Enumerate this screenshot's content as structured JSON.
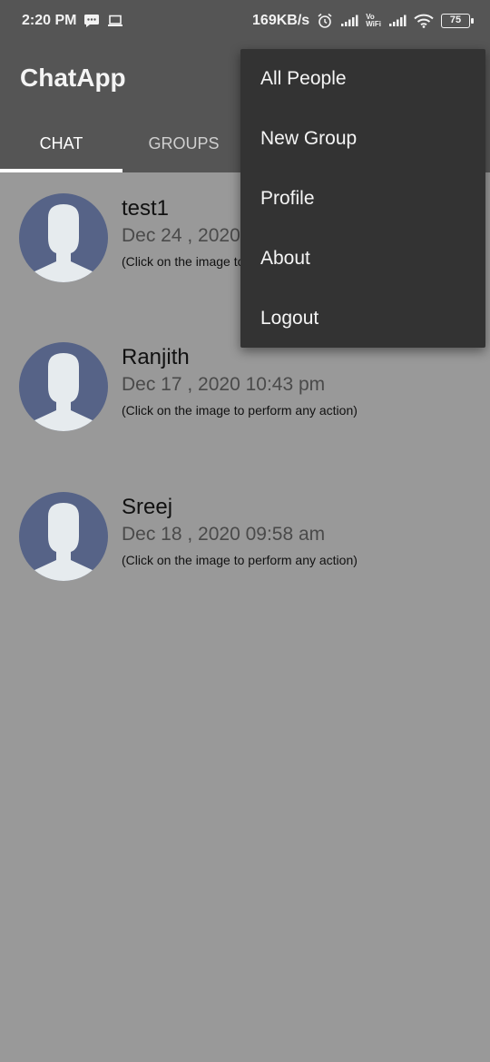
{
  "status_bar": {
    "time": "2:20 PM",
    "network_speed": "169KB/s",
    "vowifi_top": "Vo",
    "vowifi_bottom": "WiFi",
    "battery": "75",
    "icons": [
      "message-icon",
      "laptop-icon",
      "alarm-icon",
      "signal-icon",
      "signal-icon",
      "wifi-icon",
      "battery-icon"
    ]
  },
  "app_bar": {
    "title": "ChatApp"
  },
  "tabs": [
    {
      "label": "CHAT",
      "active": true
    },
    {
      "label": "GROUPS",
      "active": false
    }
  ],
  "chats": [
    {
      "name": "test1",
      "date": "Dec 24 , 2020",
      "hint": "(Click on the image to"
    },
    {
      "name": "Ranjith",
      "date": "Dec 17 , 2020 10:43 pm",
      "hint": "(Click on the image to perform any action)"
    },
    {
      "name": "Sreej",
      "date": "Dec 18 , 2020 09:58 am",
      "hint": "(Click on the image to perform any action)"
    }
  ],
  "menu": {
    "items": [
      "All People",
      "New Group",
      "Profile",
      "About",
      "Logout"
    ]
  },
  "colors": {
    "header": "#555555",
    "scrim": "#999999",
    "menu_bg": "#333333",
    "avatar_bg": "#566387",
    "avatar_figure": "#e6ebee"
  }
}
